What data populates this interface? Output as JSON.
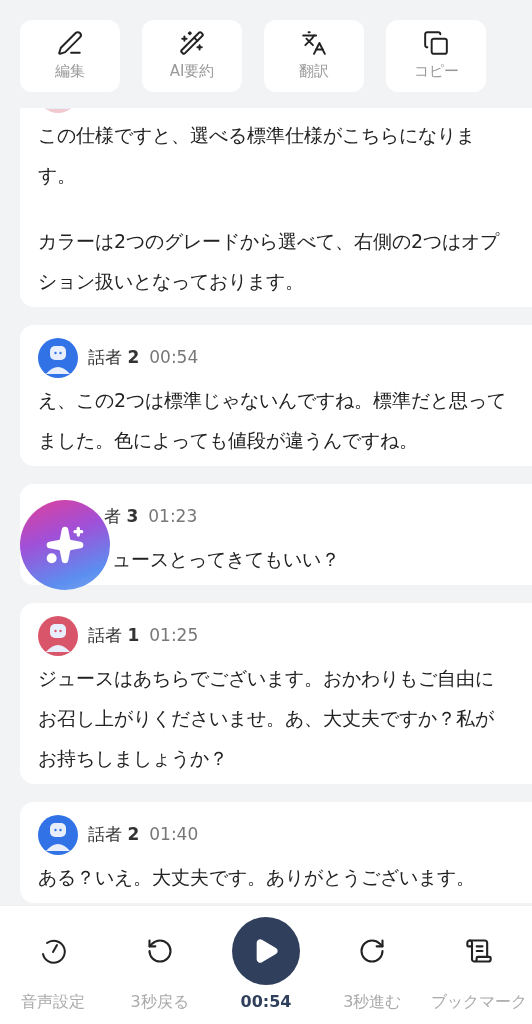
{
  "toolbar": [
    {
      "kind": "edit",
      "label": "編集"
    },
    {
      "kind": "ai",
      "label": "AI要約"
    },
    {
      "kind": "translate",
      "label": "翻訳"
    },
    {
      "kind": "copy",
      "label": "コピー"
    }
  ],
  "messages": [
    {
      "color": "#f2c9cf",
      "paragraphs": [
        "この仕様ですと、選べる標準仕様がこちらになります。",
        "カラーは2つのグレードから選べて、右側の2つはオプション扱いとなっております。"
      ]
    },
    {
      "color": "#3173e6",
      "speaker": "話者 **2**",
      "time": "00:54",
      "paragraphs": [
        "え、この2つは標準じゃないんですね。標準だと思ってました。色によっても値段が違うんですね。"
      ]
    },
    {
      "obscured": true,
      "speaker": "者 **3**",
      "time": "01:23",
      "paragraphs": [
        "ュースとってきてもいい？"
      ]
    },
    {
      "color": "#d9566a",
      "speaker": "話者 **1**",
      "time": "01:25",
      "paragraphs": [
        "ジュースはあちらでございます。おかわりもご自由にお召し上がりくださいませ。あ、大丈夫ですか？私がお持ちしましょうか？"
      ]
    },
    {
      "color": "#3173e6",
      "speaker": "話者 **2**",
      "time": "01:40",
      "paragraphs": [
        "ある？いえ。大丈夫です。ありがとうございます。"
      ]
    }
  ],
  "player": [
    {
      "kind": "speed",
      "label": "音声設定"
    },
    {
      "kind": "back",
      "label": "3秒戻る"
    },
    {
      "kind": "play",
      "label": "00:54"
    },
    {
      "kind": "forward",
      "label": "3秒進む"
    },
    {
      "kind": "bookmark",
      "label": "ブックマーク"
    }
  ]
}
